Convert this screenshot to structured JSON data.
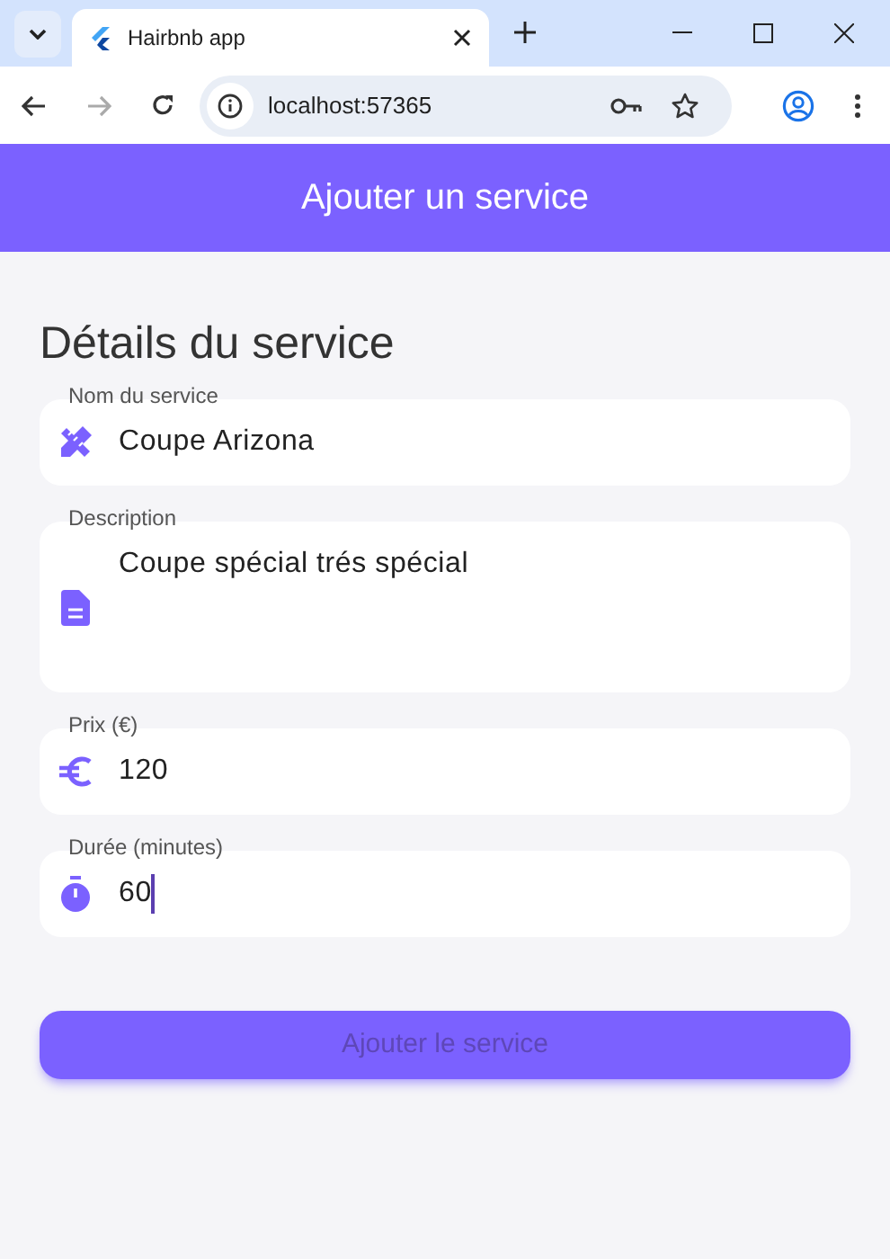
{
  "browser": {
    "tab_title": "Hairbnb app",
    "address": "localhost:57365"
  },
  "app_bar": {
    "title": "Ajouter un service"
  },
  "section_title": "Détails du service",
  "fields": [
    {
      "label": "Nom du service",
      "value": "Coupe Arizona",
      "multiline": false,
      "focused": false
    },
    {
      "label": "Description",
      "value": "Coupe spécial trés spécial",
      "multiline": true,
      "focused": false
    },
    {
      "label": "Prix (€)",
      "value": "120",
      "multiline": false,
      "focused": false
    },
    {
      "label": "Durée (minutes)",
      "value": "60",
      "multiline": false,
      "focused": true
    }
  ],
  "submit_button": {
    "label": "Ajouter le service"
  }
}
